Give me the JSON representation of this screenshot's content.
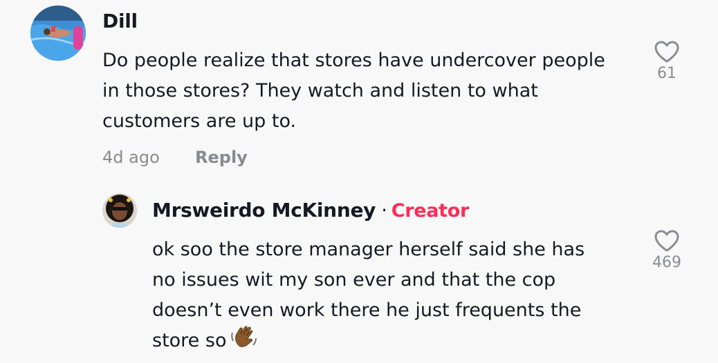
{
  "comments": [
    {
      "username": "Dill",
      "text_lines": [
        "Do people realize that stores have undercover people",
        "in those stores? They watch and listen to what",
        "customers are up to."
      ],
      "time": "4d ago",
      "reply_label": "Reply",
      "likes": "61",
      "avatar_icon": "pool-photo-avatar"
    }
  ],
  "replies": [
    {
      "username": "Mrsweirdo McKinney",
      "separator": "·",
      "badge": "Creator",
      "badge_color": "#fe2c55",
      "text_lines": [
        "ok soo the store manager herself said she has",
        "no issues wit my son ever and that the cop",
        "doesn’t even work there he just frequents the",
        "store so"
      ],
      "emoji": "waving-hand-emoji",
      "likes": "469",
      "avatar_icon": "portrait-photo-avatar"
    }
  ]
}
